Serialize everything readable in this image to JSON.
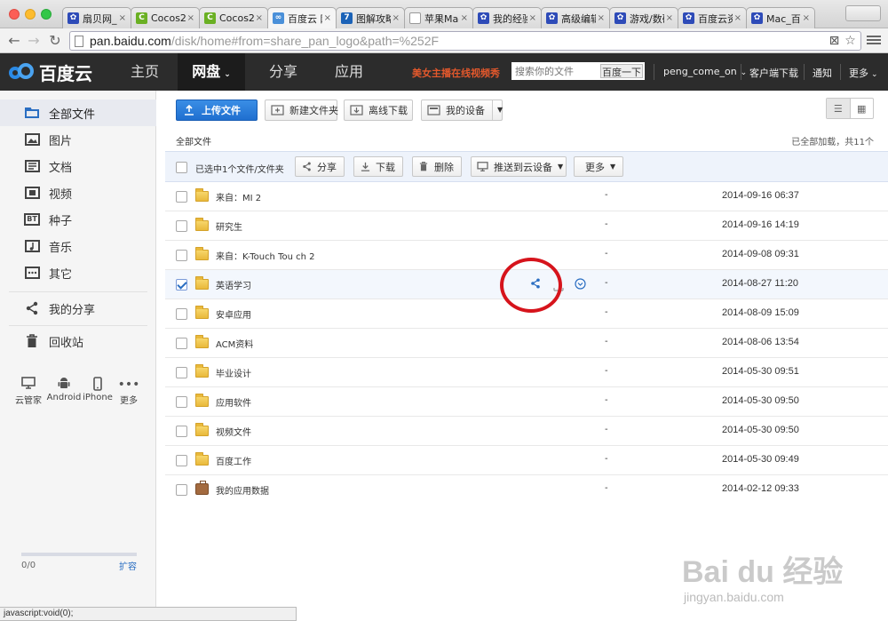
{
  "browser": {
    "tabs": [
      {
        "title": "扇贝网_",
        "favicon": "paw-icon",
        "active": false
      },
      {
        "title": "Cocos2",
        "favicon": "cocos-icon",
        "active": false
      },
      {
        "title": "Cocos2",
        "favicon": "cocos-icon",
        "active": false
      },
      {
        "title": "百度云 网",
        "favicon": "baidu-cloud-icon",
        "active": true
      },
      {
        "title": "图解攻略",
        "favicon": "seven-icon",
        "active": false
      },
      {
        "title": "苹果Mac",
        "favicon": "document-icon",
        "active": false
      },
      {
        "title": "我的经验",
        "favicon": "paw-icon",
        "active": false
      },
      {
        "title": "高级编辑",
        "favicon": "paw-icon",
        "active": false
      },
      {
        "title": "游戏/数码",
        "favicon": "paw-icon",
        "active": false
      },
      {
        "title": "百度云资",
        "favicon": "paw-icon",
        "active": false
      },
      {
        "title": "Mac_百度",
        "favicon": "paw-icon",
        "active": false
      }
    ],
    "url_host": "pan.baidu.com",
    "url_path": "/disk/home#from=share_pan_logo&path=%252F",
    "status_text": "javascript:void(0);"
  },
  "header": {
    "logo_text": "百度云",
    "nav": [
      "主页",
      "网盘",
      "分享",
      "应用"
    ],
    "promo": "美女主播在线视频秀",
    "search_placeholder": "搜索你的文件",
    "search_button": "百度一下",
    "username": "peng_come_on",
    "client_download": "客户端下载",
    "notify": "通知",
    "more": "更多"
  },
  "sidebar": {
    "items": [
      {
        "label": "全部文件",
        "icon": "folder-outline-icon"
      },
      {
        "label": "图片",
        "icon": "image-icon"
      },
      {
        "label": "文档",
        "icon": "document-icon"
      },
      {
        "label": "视频",
        "icon": "video-icon"
      },
      {
        "label": "种子",
        "icon": "bt-icon"
      },
      {
        "label": "音乐",
        "icon": "music-icon"
      },
      {
        "label": "其它",
        "icon": "other-icon"
      }
    ],
    "my_share": "我的分享",
    "recycle": "回收站",
    "devices": [
      {
        "label": "云管家",
        "icon": "monitor-icon"
      },
      {
        "label": "Android",
        "icon": "android-icon"
      },
      {
        "label": "iPhone",
        "icon": "iphone-icon"
      },
      {
        "label": "更多",
        "icon": "ellipsis-icon"
      }
    ],
    "quota_used": "0/0",
    "quota_expand": "扩容"
  },
  "toolbar": {
    "upload": "上传文件",
    "new_folder": "新建文件夹",
    "offline_download": "离线下载",
    "my_devices": "我的设备"
  },
  "breadcrumb": "全部文件",
  "load_status": "已全部加载，共11个",
  "selection_bar": {
    "text": "已选中1个文件/文件夹",
    "share": "分享",
    "download": "下载",
    "delete": "删除",
    "push": "推送到云设备",
    "more": "更多"
  },
  "files": [
    {
      "name": "来自：MI 2",
      "size": "-",
      "date": "2014-09-16 06:37",
      "type": "folder",
      "checked": false
    },
    {
      "name": "研究生",
      "size": "-",
      "date": "2014-09-16 14:19",
      "type": "folder",
      "checked": false
    },
    {
      "name": "来自：K-Touch Tou ch 2",
      "size": "-",
      "date": "2014-09-08 09:31",
      "type": "folder",
      "checked": false
    },
    {
      "name": "英语学习",
      "size": "-",
      "date": "2014-08-27 11:20",
      "type": "folder",
      "checked": true
    },
    {
      "name": "安卓应用",
      "size": "-",
      "date": "2014-08-09 15:09",
      "type": "folder",
      "checked": false
    },
    {
      "name": "ACM资料",
      "size": "-",
      "date": "2014-08-06 13:54",
      "type": "folder",
      "checked": false
    },
    {
      "name": "毕业设计",
      "size": "-",
      "date": "2014-05-30 09:51",
      "type": "folder",
      "checked": false
    },
    {
      "name": "应用软件",
      "size": "-",
      "date": "2014-05-30 09:50",
      "type": "folder",
      "checked": false
    },
    {
      "name": "视频文件",
      "size": "-",
      "date": "2014-05-30 09:50",
      "type": "folder",
      "checked": false
    },
    {
      "name": "百度工作",
      "size": "-",
      "date": "2014-05-30 09:49",
      "type": "folder",
      "checked": false
    },
    {
      "name": "我的应用数据",
      "size": "-",
      "date": "2014-02-12 09:33",
      "type": "app-data",
      "checked": false
    }
  ],
  "watermark": {
    "brand": "Bai du 经验",
    "url": "jingyan.baidu.com"
  },
  "colors": {
    "header_bg": "#2c2c2c",
    "accent_blue": "#1f6fd0",
    "promo_orange": "#e2582c",
    "highlight_red": "#d6141c"
  }
}
